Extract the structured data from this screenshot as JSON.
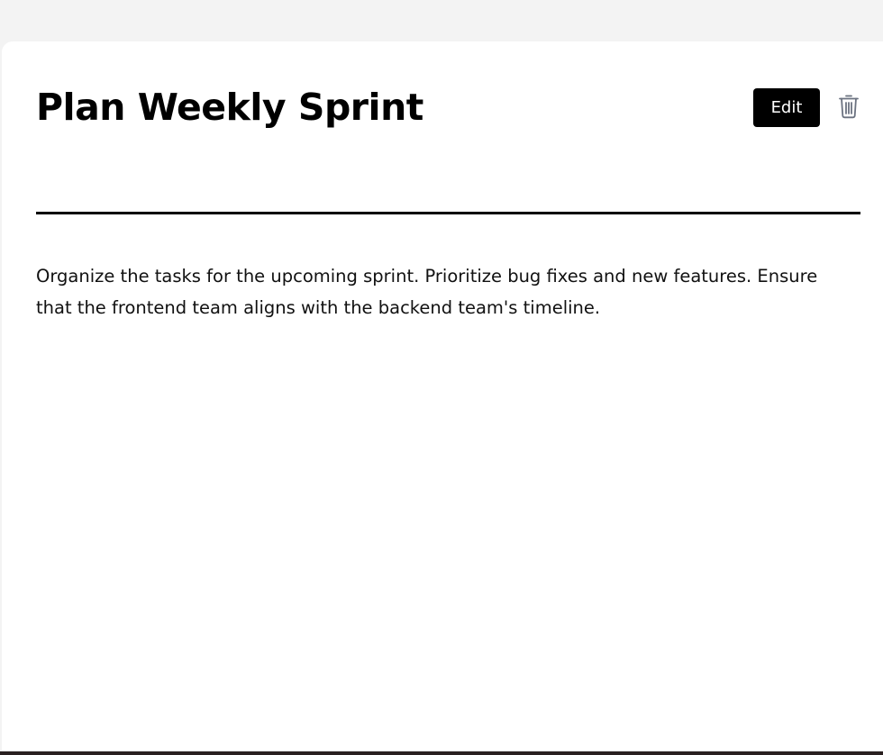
{
  "task": {
    "title": "Plan Weekly Sprint",
    "description": "Organize the tasks for the upcoming sprint. Prioritize bug fixes and new features. Ensure that the frontend team aligns with the backend team's timeline.",
    "edit_label": "Edit",
    "delete_icon": "trash-icon"
  },
  "colors": {
    "background": "#f3f3f3",
    "card": "#ffffff",
    "text": "#000000",
    "button_bg": "#000000",
    "button_text": "#ffffff",
    "icon": "#6b7280"
  }
}
